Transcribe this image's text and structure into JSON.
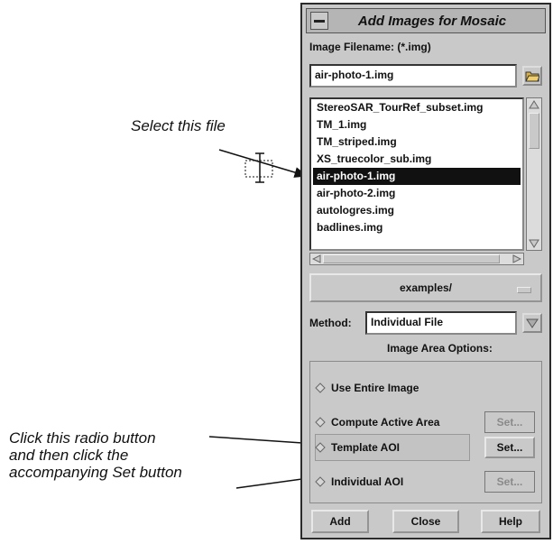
{
  "annotations": {
    "select_file": "Select this file",
    "radio_instruction_line1": "Click this radio button",
    "radio_instruction_line2": "and then click the",
    "radio_instruction_line3": "accompanying Set button"
  },
  "dialog": {
    "title": "Add Images for Mosaic",
    "filename_label": "Image Filename: (*.img)",
    "filename_value": "air-photo-1.img",
    "files": [
      "StereoSAR_TourRef_subset.img",
      "TM_1.img",
      "TM_striped.img",
      "XS_truecolor_sub.img",
      "air-photo-1.img",
      "air-photo-2.img",
      "autologres.img",
      "badlines.img"
    ],
    "selected_index": 4,
    "directory": "examples/",
    "method_label": "Method:",
    "method_value": "Individual File",
    "options_title": "Image Area Options:",
    "options": [
      {
        "label": "Use Entire Image",
        "set_label": ""
      },
      {
        "label": "Compute Active Area",
        "set_label": "Set..."
      },
      {
        "label": "Template AOI",
        "set_label": "Set..."
      },
      {
        "label": "Individual AOI",
        "set_label": "Set..."
      }
    ],
    "buttons": {
      "add": "Add",
      "close": "Close",
      "help": "Help"
    }
  },
  "icons": {
    "window_menu": "window-menu-icon",
    "folder": "folder-icon",
    "radio": "radio-diamond-icon",
    "cursor": "ibeam-cursor-icon",
    "dropdown": "dropdown-arrow-icon"
  },
  "colors": {
    "dialog_bg": "#c9c9c9",
    "selection_bg": "#111111",
    "selection_fg": "#ffffff",
    "disabled_text": "#8a8a8a"
  }
}
